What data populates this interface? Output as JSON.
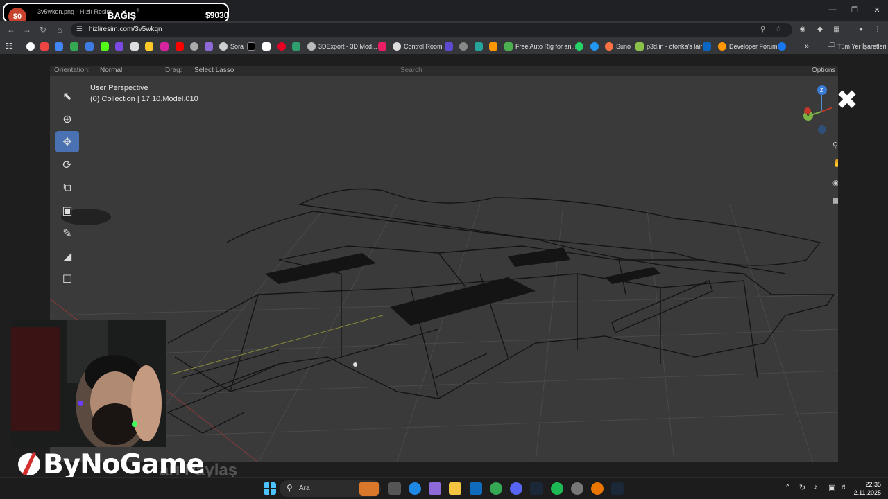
{
  "browser": {
    "tab": {
      "donate_badge": "$0",
      "title": "3v5wkqn.png - Hızlı Resim",
      "bagis_label": "BAĞIŞ",
      "plus": "+",
      "amount": "$9030"
    },
    "url": "hizliresim.com/3v5wkqn",
    "bookmarks": [
      {
        "label": "Sora",
        "color": "#cfcfcf"
      },
      {
        "label": "3DExport - 3D Mod...",
        "color": "#bbbbbb"
      },
      {
        "label": "Control Room",
        "color": "#dddddd"
      },
      {
        "label": "Free Auto Rig for an...",
        "color": "#4caf50"
      },
      {
        "label": "Suno",
        "color": "#ff7043"
      },
      {
        "label": "p3d.in - otonka's lair",
        "color": "#8bc34a"
      },
      {
        "label": "Developer Forum",
        "color": "#ff9800"
      }
    ],
    "all_bookmarks": "Tüm Yer İşaretleri"
  },
  "viewport": {
    "header": {
      "orientation_label": "Orientation:",
      "orientation_value": "Normal",
      "drag_label": "Drag:",
      "drag_value": "Select Lasso",
      "search_placeholder": "Search",
      "options": "Options"
    },
    "perspective": "User Perspective",
    "collection": "(0) Collection | 17.10.Model.010",
    "gizmo": {
      "z": "Z",
      "y": "Y"
    }
  },
  "overlay": {
    "bottom_text": "arı Paylaş",
    "logo": "ByNoGame"
  },
  "taskbar": {
    "search_placeholder": "Ara",
    "time": "22:35",
    "date": "2.11.2025"
  }
}
